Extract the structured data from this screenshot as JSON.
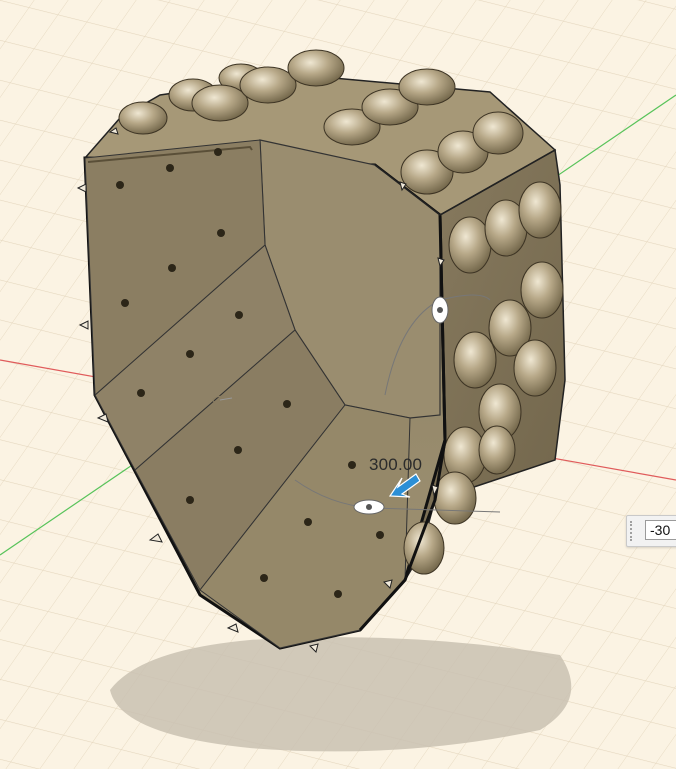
{
  "app": {
    "view": "3d-model-viewport"
  },
  "model": {
    "name": "",
    "color": "#a89a7a"
  },
  "sketch_dimension": {
    "label": "300.00",
    "input_value": "-30"
  },
  "axes": {
    "x_color": "#e05b5b",
    "y_color": "#58c35a"
  },
  "icons": [
    "rotate-handle-icon",
    "drag-arrow-icon",
    "grip-icon"
  ]
}
